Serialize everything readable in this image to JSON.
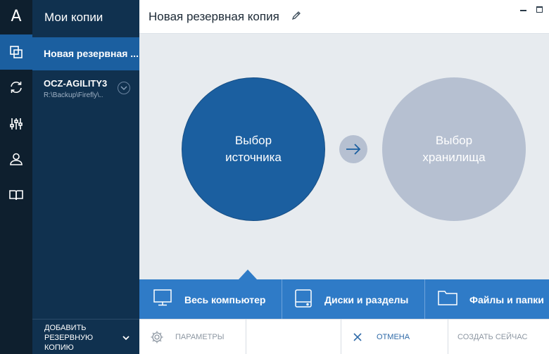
{
  "app": {
    "logo": "A"
  },
  "rail": {
    "items": [
      {
        "icon": "backups-icon",
        "active": true
      },
      {
        "icon": "sync-icon",
        "active": false
      },
      {
        "icon": "tools-icon",
        "active": false
      },
      {
        "icon": "account-icon",
        "active": false
      },
      {
        "icon": "help-book-icon",
        "active": false
      }
    ]
  },
  "panel": {
    "title": "Мои копии",
    "items": [
      {
        "name": "Новая резервная ..."
      },
      {
        "name": "OCZ-AGILITY3",
        "path": "R:\\Backup\\Firefly\\.."
      }
    ],
    "add_button": "ДОБАВИТЬ РЕЗЕРВНУЮ КОПИЮ"
  },
  "header": {
    "title": "Новая резервная копия"
  },
  "main": {
    "source_label": "Выбор источника",
    "destination_label": "Выбор хранилища"
  },
  "source_types": {
    "whole_pc": "Весь компьютер",
    "disks": "Диски и разделы",
    "files": "Файлы и папки"
  },
  "footer": {
    "settings": "ПАРАМЕТРЫ",
    "cancel": "ОТМЕНА",
    "create": "СОЗДАТЬ СЕЙЧАС"
  },
  "colors": {
    "accent": "#1b5fa0",
    "bar": "#2f7bc7",
    "rail": "#0e1f2e",
    "panel": "#10314f",
    "inactive_circle": "#b6c0d1"
  }
}
